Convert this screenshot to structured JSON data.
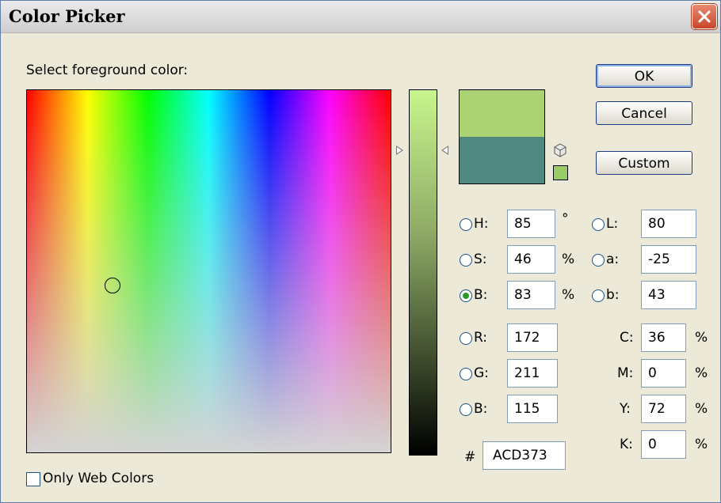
{
  "window": {
    "title": "Color Picker"
  },
  "prompt": "Select foreground color:",
  "buttons": {
    "ok": "OK",
    "cancel": "Cancel",
    "custom": "Custom"
  },
  "colors": {
    "new": "#acd373",
    "current": "#508880",
    "websafe": "#99cc66"
  },
  "picker": {
    "hue": 85,
    "saturation_pct": 46,
    "brightness_pct": 83
  },
  "hsb": [
    {
      "key": "h",
      "label": "H:",
      "value": "85",
      "unit": "°",
      "selected": false
    },
    {
      "key": "s",
      "label": "S:",
      "value": "46",
      "unit": "%",
      "selected": false
    },
    {
      "key": "b",
      "label": "B:",
      "value": "83",
      "unit": "%",
      "selected": true
    }
  ],
  "lab": [
    {
      "key": "l",
      "label": "L:",
      "value": "80"
    },
    {
      "key": "a",
      "label": "a:",
      "value": "-25"
    },
    {
      "key": "b",
      "label": "b:",
      "value": "43"
    }
  ],
  "rgb": [
    {
      "key": "r",
      "label": "R:",
      "value": "172"
    },
    {
      "key": "g",
      "label": "G:",
      "value": "211"
    },
    {
      "key": "b",
      "label": "B:",
      "value": "115"
    }
  ],
  "cmyk": [
    {
      "key": "c",
      "label": "C:",
      "value": "36",
      "unit": "%"
    },
    {
      "key": "m",
      "label": "M:",
      "value": "0",
      "unit": "%"
    },
    {
      "key": "y",
      "label": "Y:",
      "value": "72",
      "unit": "%"
    },
    {
      "key": "k",
      "label": "K:",
      "value": "0",
      "unit": "%"
    }
  ],
  "hex": {
    "symbol": "#",
    "value": "ACD373"
  },
  "web_only": {
    "label": "Only Web Colors",
    "checked": false
  },
  "icons": {
    "close": "close-icon",
    "gamut": "out-of-gamut-cube-icon"
  }
}
